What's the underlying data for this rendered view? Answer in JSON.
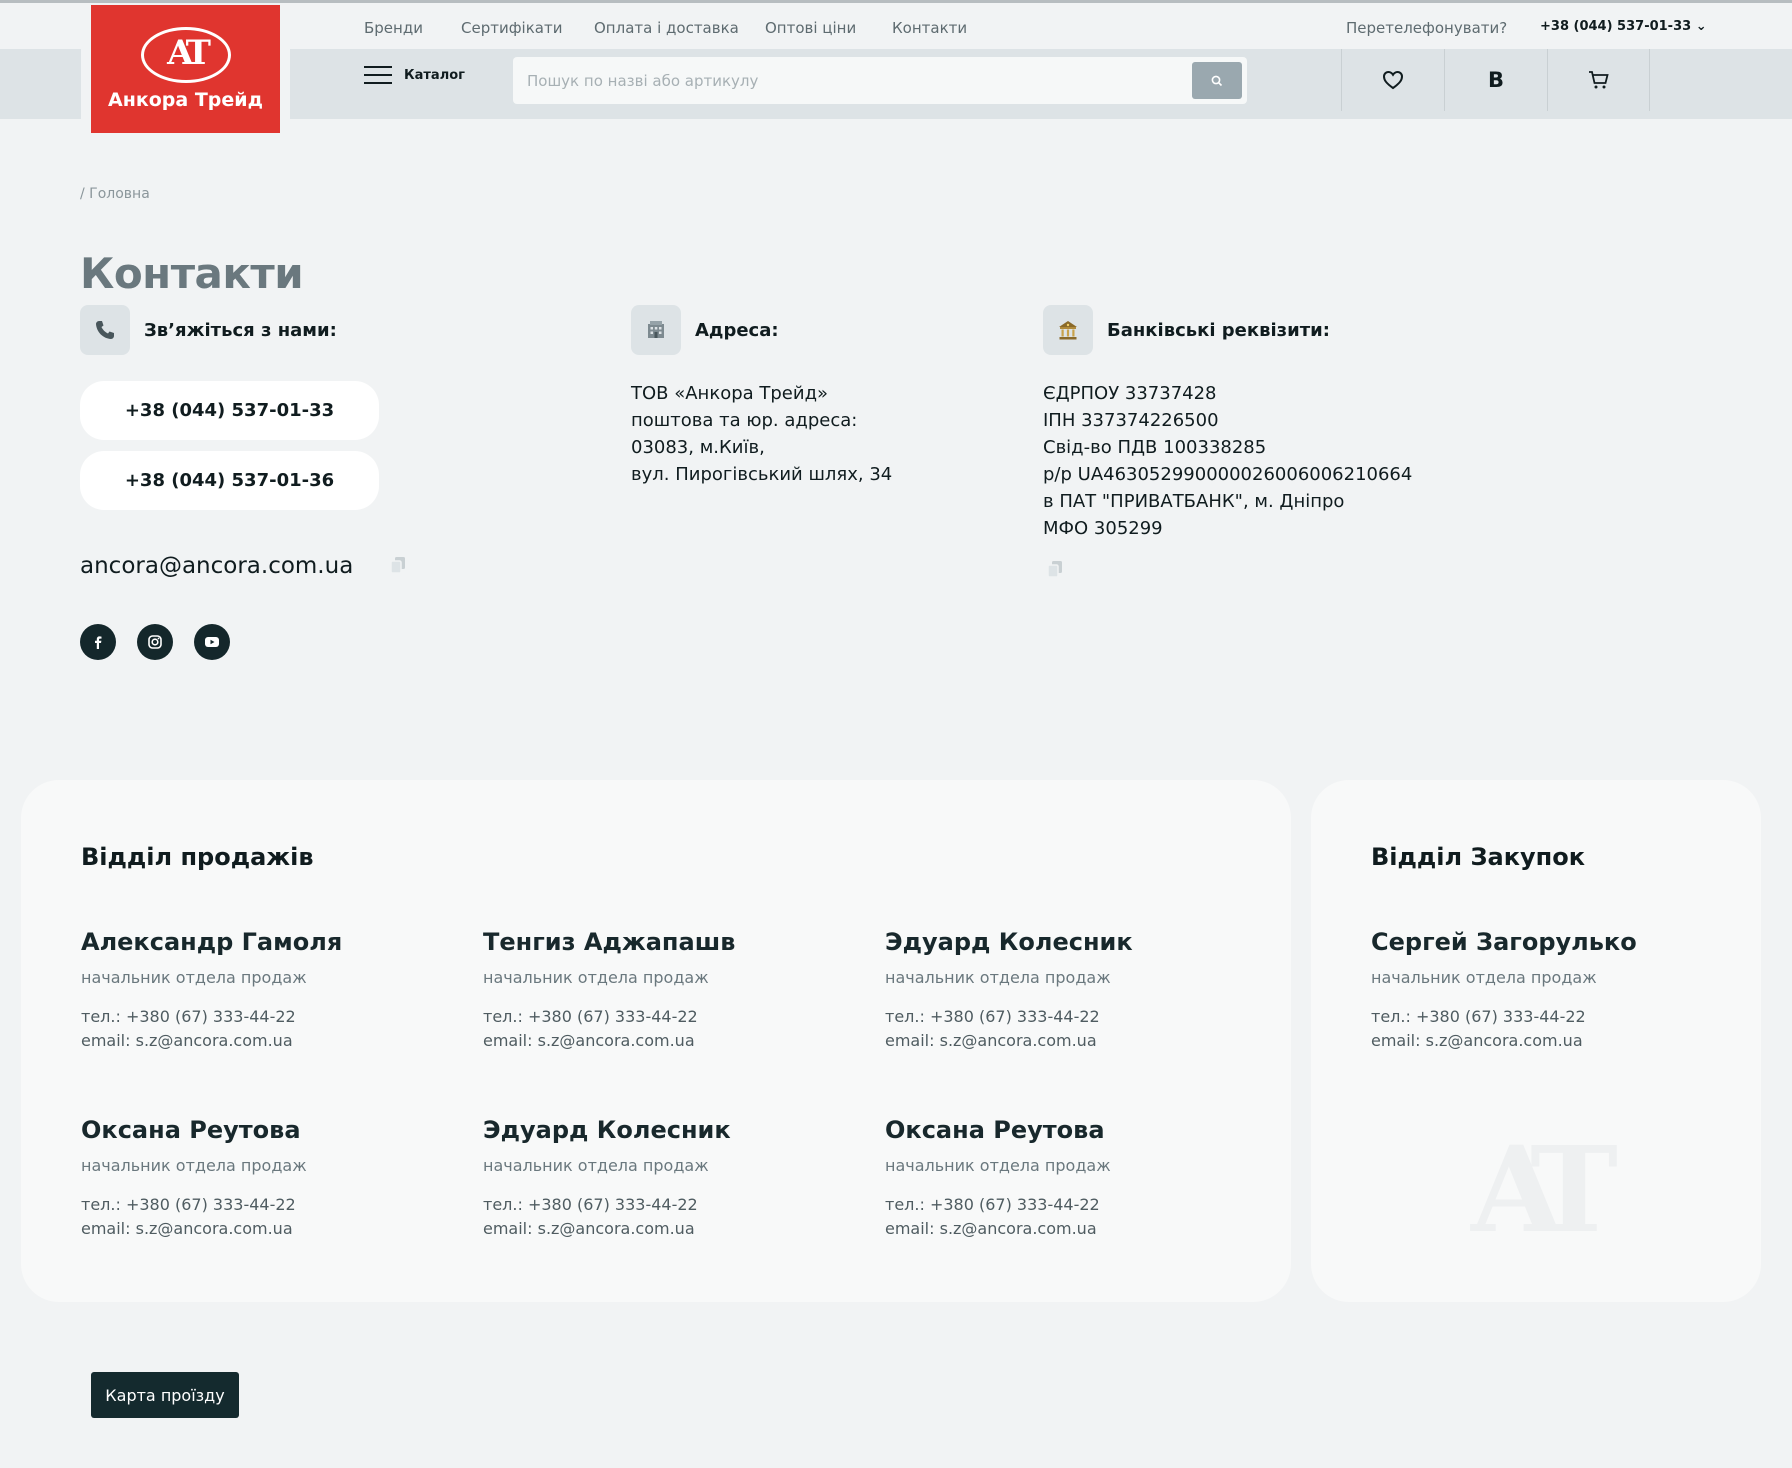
{
  "header": {
    "nav": [
      "Бренди",
      "Сертифікати",
      "Оплата і доставка",
      "Оптові ціни",
      "Контакти"
    ],
    "callback": "Перетелефонувати?",
    "phone": "+38 (044) 537-01-33 ⌄",
    "logo_text": "Анкора Трейд",
    "logo_mark": "AT",
    "catalog_label": "Каталог",
    "search_placeholder": "Пошук по назві або артикулу",
    "lang": "B"
  },
  "breadcrumb": "/  Головна",
  "page_title": "Контакти",
  "contact": {
    "title": "Зв’яжіться з нами:",
    "phones": [
      "+38 (044) 537-01-33",
      "+38 (044) 537-01-36"
    ],
    "email": "ancora@ancora.com.ua"
  },
  "address": {
    "title": "Адреса:",
    "lines": [
      "ТОВ «Анкора Трейд»",
      "поштова та юр. адреса:",
      "03083, м.Київ,",
      "вул. Пирогівський шлях, 34"
    ]
  },
  "bank": {
    "title": "Банківські реквізити:",
    "lines": [
      "ЄДРПОУ 33737428",
      "ІПН 337374226500",
      "Свід-во ПДВ 100338285",
      "р/р UA463052990000026006006210664",
      "в ПАТ \"ПРИВАТБАНК\", м. Дніпро",
      "МФО 305299"
    ]
  },
  "sales": {
    "title": "Відділ продажів",
    "people": [
      {
        "name": "Александр Гамоля",
        "role": "начальник отдела продаж",
        "phone": "тел.: +380 (67) 333-44-22",
        "email": "email: s.z@ancora.com.ua"
      },
      {
        "name": "Тенгиз Аджапашв",
        "role": "начальник отдела продаж",
        "phone": "тел.: +380 (67) 333-44-22",
        "email": "email: s.z@ancora.com.ua"
      },
      {
        "name": "Эдуард Колесник",
        "role": "начальник отдела продаж",
        "phone": "тел.: +380 (67) 333-44-22",
        "email": "email: s.z@ancora.com.ua"
      },
      {
        "name": "Оксана Реутова",
        "role": "начальник отдела продаж",
        "phone": "тел.: +380 (67) 333-44-22",
        "email": "email: s.z@ancora.com.ua"
      },
      {
        "name": "Эдуард Колесник",
        "role": "начальник отдела продаж",
        "phone": "тел.: +380 (67) 333-44-22",
        "email": "email: s.z@ancora.com.ua"
      },
      {
        "name": "Оксана Реутова",
        "role": "начальник отдела продаж",
        "phone": "тел.: +380 (67) 333-44-22",
        "email": "email: s.z@ancora.com.ua"
      }
    ]
  },
  "purchase": {
    "title": "Відділ Закупок",
    "people": [
      {
        "name": "Сергей Загорулько",
        "role": "начальник отдела продаж",
        "phone": "тел.: +380 (67) 333-44-22",
        "email": "email: s.z@ancora.com.ua"
      }
    ]
  },
  "map_button": "Карта проїзду",
  "icons": {
    "contact": "phone-icon",
    "address": "building-icon",
    "bank": "bank-icon",
    "header": [
      "heart-icon",
      "cart-icon",
      "search-icon"
    ],
    "socials": [
      "facebook-icon",
      "instagram-icon",
      "youtube-icon"
    ]
  },
  "colors": {
    "brand_red": "#e0352f",
    "dark": "#142a2e",
    "page_bg": "#f1f3f4",
    "header_bg": "#dde3e6"
  }
}
